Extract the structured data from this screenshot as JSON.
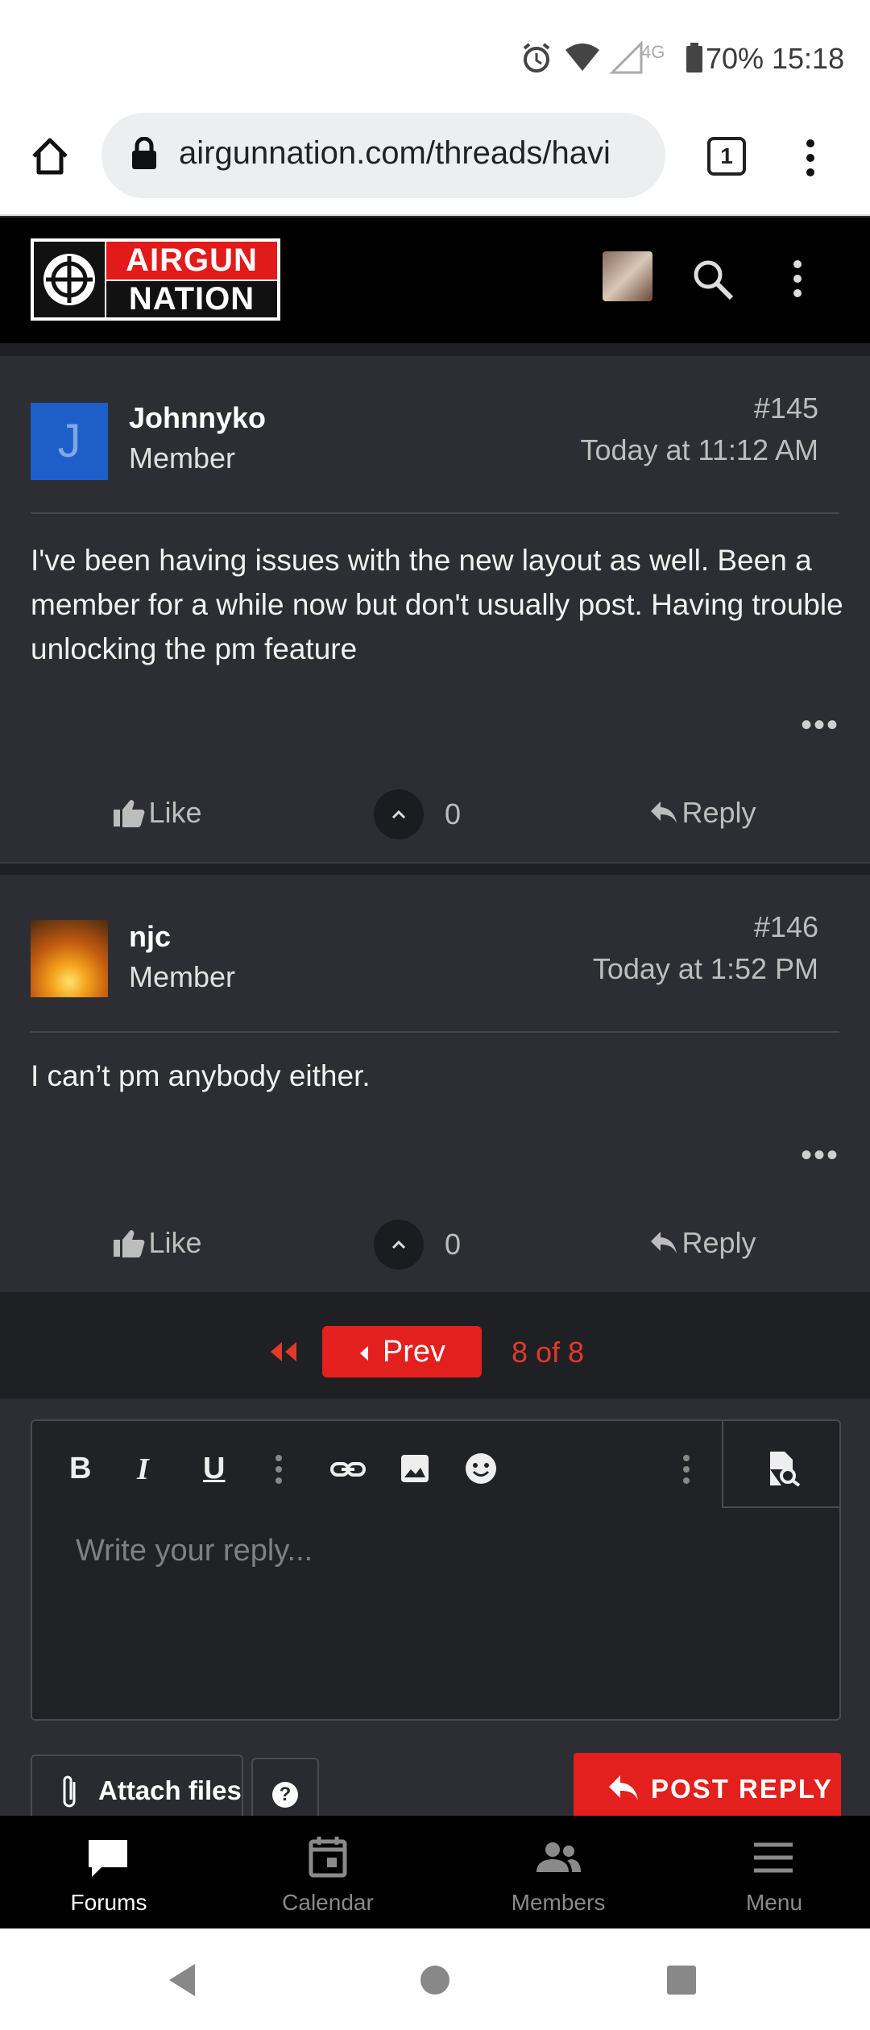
{
  "status_bar": {
    "battery": "70%",
    "time": "15:18",
    "network": "4G"
  },
  "browser": {
    "url": "airgunnation.com/threads/havi",
    "tab_count": "1"
  },
  "site": {
    "logo_top": "AIRGUN",
    "logo_bottom": "NATION"
  },
  "posts": [
    {
      "avatar_letter": "J",
      "avatar_color": "#1e5ec8",
      "username": "Johnnyko",
      "role": "Member",
      "number": "#145",
      "date": "Today at 11:12 AM",
      "body": "I've been having issues with the new layout as well. Been a member for a while now but don't usually post. Having trouble unlocking the pm feature",
      "more": "•••",
      "like_label": "Like",
      "vote_count": "0",
      "reply_label": "Reply"
    },
    {
      "username": "njc",
      "role": "Member",
      "number": "#146",
      "date": "Today at 1:52 PM",
      "body": "I can’t pm anybody either.",
      "more": "•••",
      "like_label": "Like",
      "vote_count": "0",
      "reply_label": "Reply"
    }
  ],
  "pagination": {
    "prev_label": "Prev",
    "page_of": "8 of 8"
  },
  "editor": {
    "placeholder": "Write your reply...",
    "toolbar": [
      "B",
      "I",
      "U"
    ]
  },
  "actions": {
    "attach_label": "Attach files",
    "help_label": "?",
    "post_reply_label": "POST REPLY"
  },
  "bottom_nav": [
    {
      "label": "Forums",
      "active": true
    },
    {
      "label": "Calendar",
      "active": false
    },
    {
      "label": "Members",
      "active": false
    },
    {
      "label": "Menu",
      "active": false
    }
  ],
  "colors": {
    "accent": "#e3201e",
    "background": "#2d2e33",
    "header": "#000000"
  }
}
